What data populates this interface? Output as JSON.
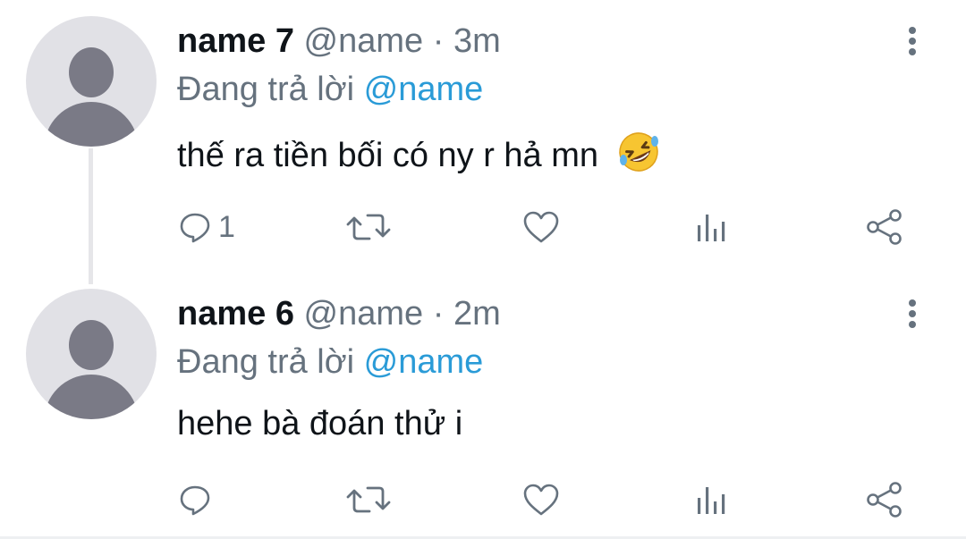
{
  "tweets": [
    {
      "name": "name 7",
      "handle": "@name",
      "separator": " · ",
      "time": "3m",
      "reply_prefix": "Đang trả lời ",
      "reply_to": "@name",
      "text": "thế ra tiền bối có ny r hả mn",
      "emoji": "rolling-on-floor-laughing",
      "reply_count": "1"
    },
    {
      "name": "name 6",
      "handle": "@name",
      "separator": " · ",
      "time": "2m",
      "reply_prefix": "Đang trả lời ",
      "reply_to": "@name",
      "text": "hehe bà đoán thử i",
      "reply_count": ""
    }
  ],
  "icons": {
    "reply": "comment-icon",
    "retweet": "retweet-icon",
    "like": "heart-icon",
    "views": "analytics-icon",
    "share": "share-icon",
    "more": "more-vertical-icon"
  },
  "colors": {
    "mention": "#2a9bd7",
    "secondary_text": "#66727e",
    "primary_text": "#0f1419",
    "avatar_bg": "#e1e1e6",
    "avatar_fg": "#7a7a86"
  }
}
